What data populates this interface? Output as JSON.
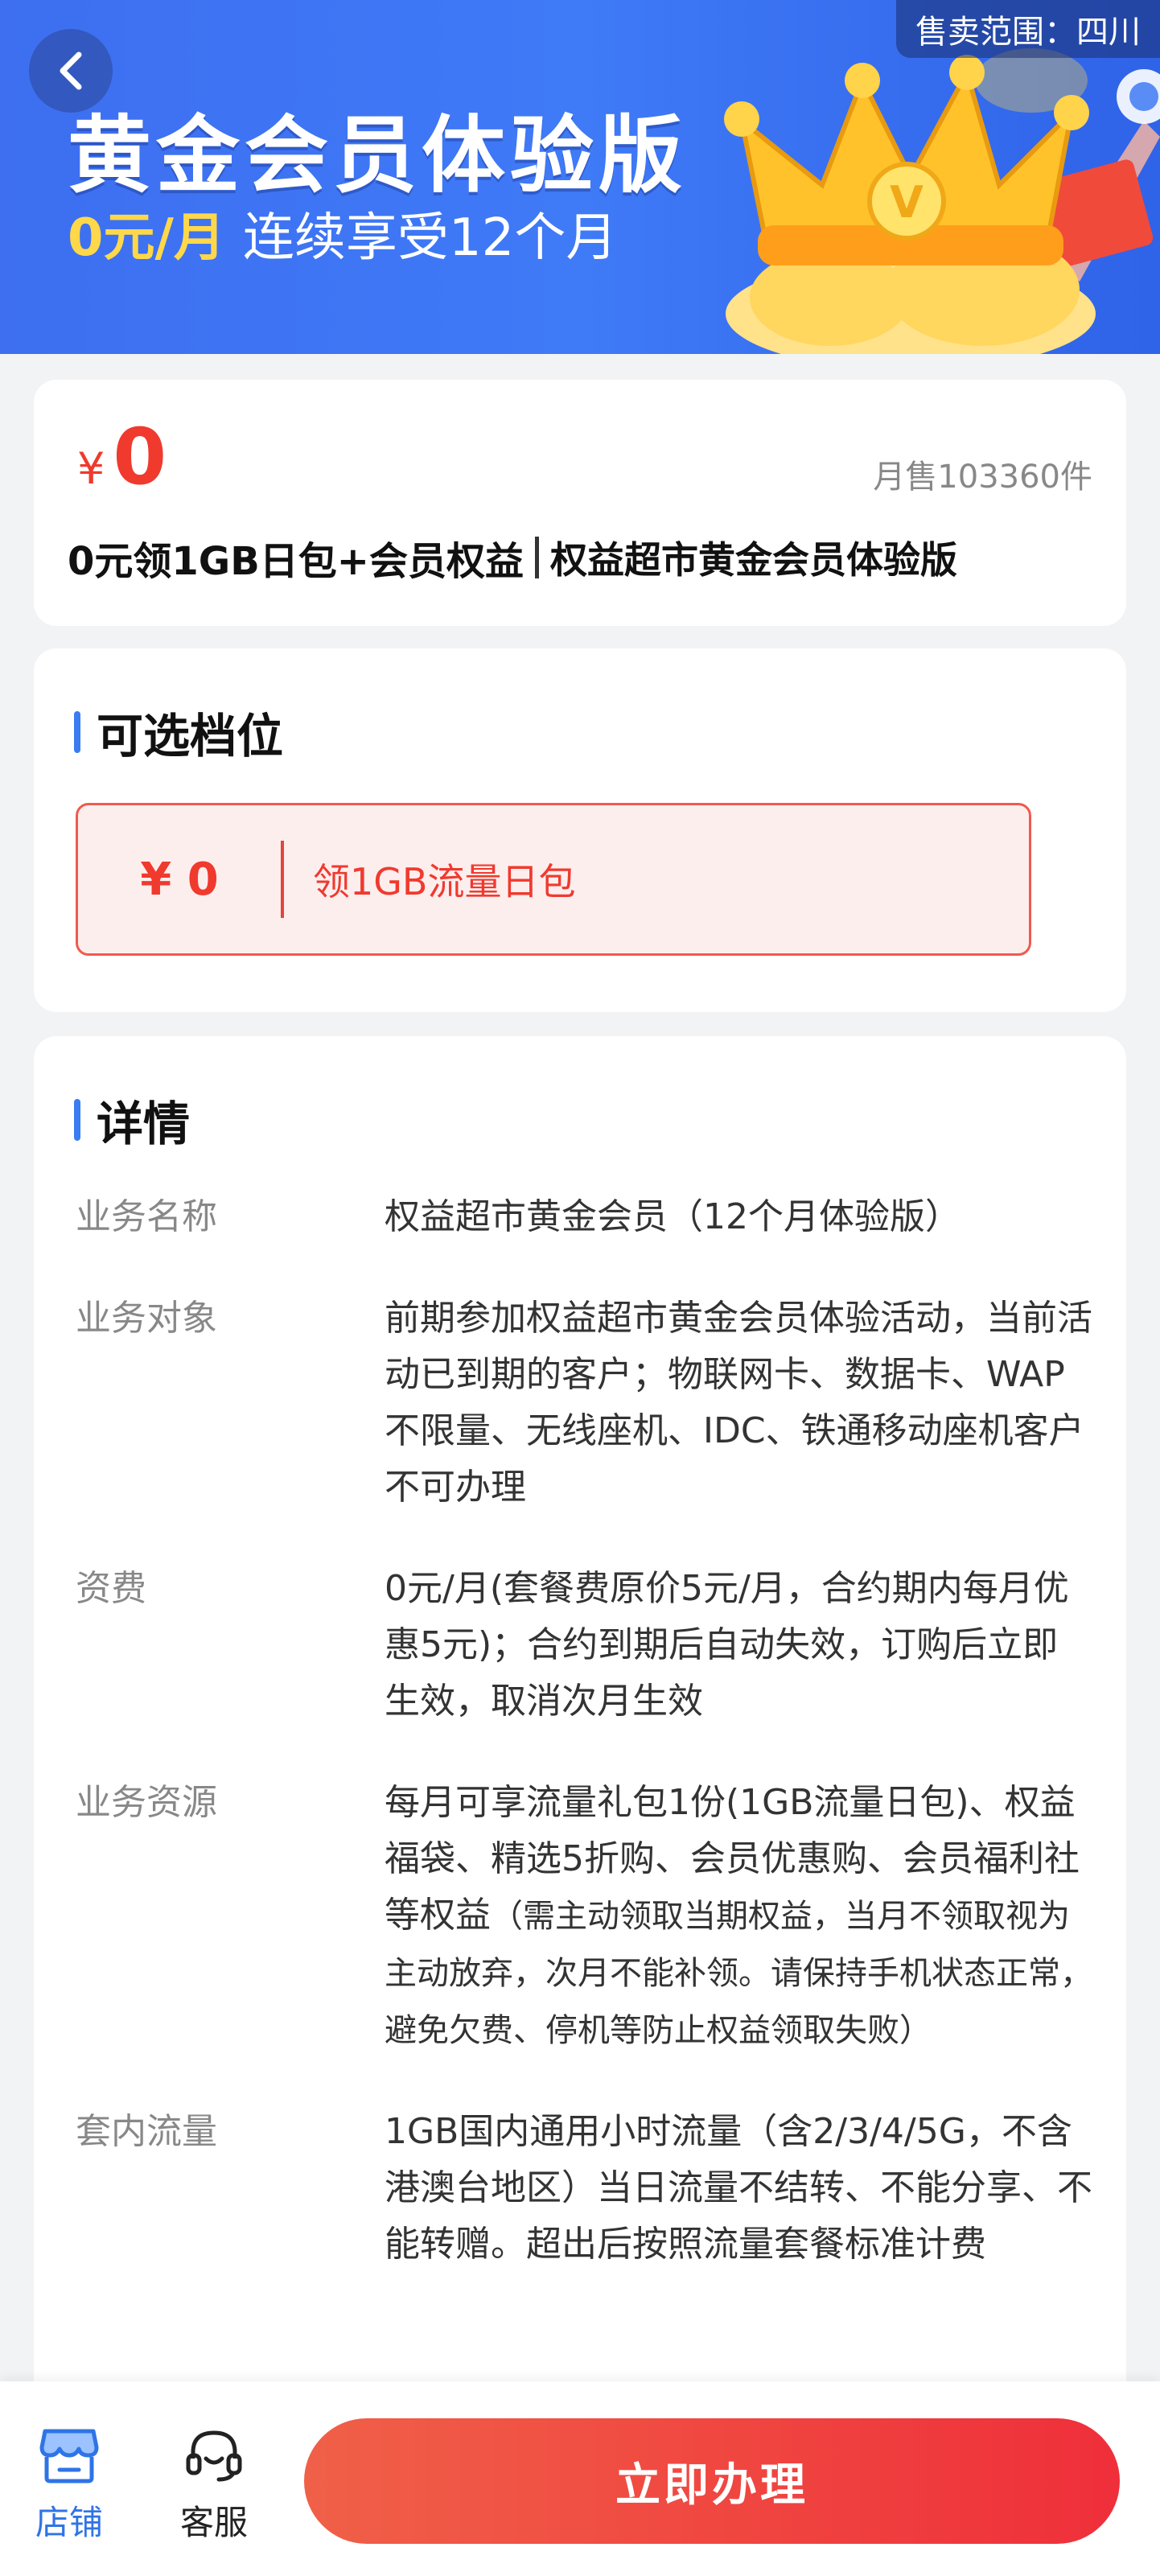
{
  "banner": {
    "title": "黄金会员体验版",
    "price": "0元/月",
    "subtitle": "连续享受12个月",
    "region": "售卖范围：四川"
  },
  "product": {
    "currency": "¥",
    "price": "0",
    "monthly_sales": "月售103360件",
    "title_main": "0元领1GB日包+会员权益",
    "title_sub": "权益超市黄金会员体验版"
  },
  "tiers": {
    "heading": "可选档位",
    "option": {
      "price": "¥ 0",
      "label": "领1GB流量日包"
    }
  },
  "details": {
    "heading": "详情",
    "rows": [
      {
        "key": "业务名称",
        "value": "权益超市黄金会员（12个月体验版）"
      },
      {
        "key": "业务对象",
        "value": "前期参加权益超市黄金会员体验活动，当前活动已到期的客户；物联网卡、数据卡、WAP不限量、无线座机、IDC、铁通移动座机客户不可办理"
      },
      {
        "key": "资费",
        "value": "0元/月(套餐费原价5元/月，合约期内每月优惠5元)；合约到期后自动失效，订购后立即生效，取消次月生效"
      },
      {
        "key": "业务资源",
        "value": "每月可享流量礼包1份(1GB流量日包)、权益福袋、精选5折购、会员优惠购、会员福利社等权益",
        "note": "（需主动领取当期权益，当月不领取视为主动放弃，次月不能补领。请保持手机状态正常，避免欠费、停机等防止权益领取失败）"
      },
      {
        "key": "套内流量",
        "value": "1GB国内通用小时流量（含2/3/4/5G，不含港澳台地区）当日流量不结转、不能分享、不能转赠。超出后按照流量套餐标准计费"
      }
    ]
  },
  "bottom_bar": {
    "store": "店铺",
    "service": "客服",
    "apply": "立即办理"
  },
  "colors": {
    "brand_blue": "#3d6ff0",
    "price_red": "#f03a2e",
    "accent_gold": "#ffd84a"
  }
}
